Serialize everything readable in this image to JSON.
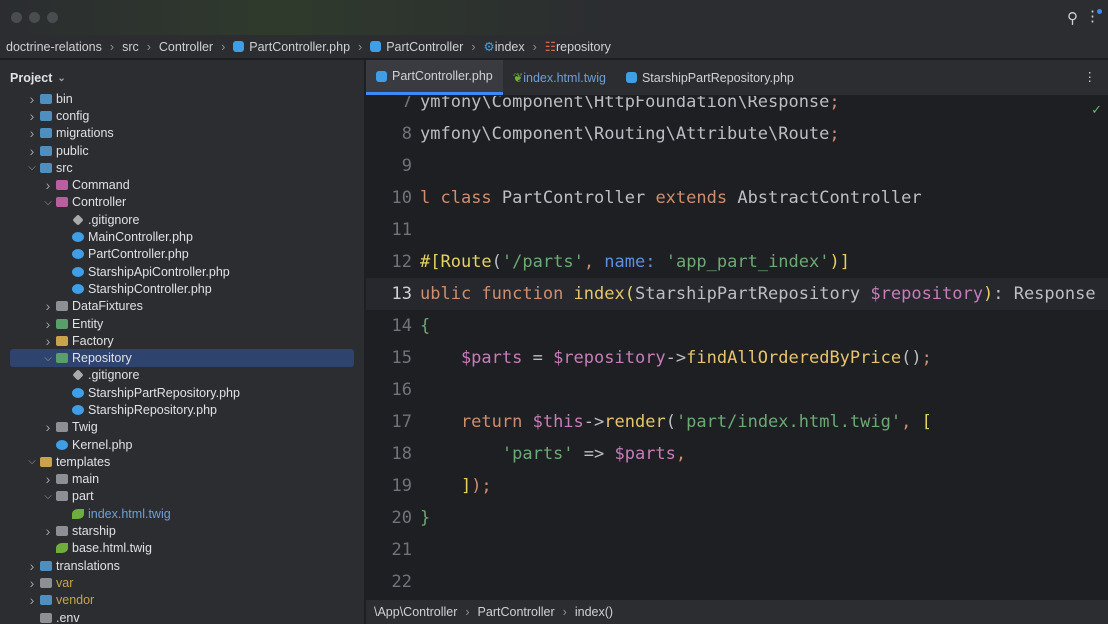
{
  "breadcrumb": [
    "doctrine-relations",
    "src",
    "Controller",
    "PartController.php",
    "PartController",
    "index",
    "repository"
  ],
  "sidebar": {
    "title": "Project",
    "tree": [
      {
        "l": 1,
        "n": "bin",
        "t": "folder",
        "c": ">"
      },
      {
        "l": 1,
        "n": "config",
        "t": "folder",
        "c": ">"
      },
      {
        "l": 1,
        "n": "migrations",
        "t": "folder",
        "c": ">"
      },
      {
        "l": 1,
        "n": "public",
        "t": "folder",
        "c": ">"
      },
      {
        "l": 1,
        "n": "src",
        "t": "folder",
        "c": "v"
      },
      {
        "l": 2,
        "n": "Command",
        "t": "folder",
        "c": ">"
      },
      {
        "l": 2,
        "n": "Controller",
        "t": "folder",
        "c": "v"
      },
      {
        "l": 3,
        "n": ".gitignore",
        "t": "git",
        "c": ""
      },
      {
        "l": 3,
        "n": "MainController.php",
        "t": "php",
        "c": ""
      },
      {
        "l": 3,
        "n": "PartController.php",
        "t": "php",
        "c": ""
      },
      {
        "l": 3,
        "n": "StarshipApiController.php",
        "t": "php",
        "c": ""
      },
      {
        "l": 3,
        "n": "StarshipController.php",
        "t": "php",
        "c": ""
      },
      {
        "l": 2,
        "n": "DataFixtures",
        "t": "folder",
        "c": ">"
      },
      {
        "l": 2,
        "n": "Entity",
        "t": "folder",
        "c": ">"
      },
      {
        "l": 2,
        "n": "Factory",
        "t": "folder",
        "c": ">"
      },
      {
        "l": 2,
        "n": "Repository",
        "t": "folder",
        "c": "v",
        "sel": true
      },
      {
        "l": 3,
        "n": ".gitignore",
        "t": "git",
        "c": ""
      },
      {
        "l": 3,
        "n": "StarshipPartRepository.php",
        "t": "php",
        "c": ""
      },
      {
        "l": 3,
        "n": "StarshipRepository.php",
        "t": "php",
        "c": ""
      },
      {
        "l": 2,
        "n": "Twig",
        "t": "folder",
        "c": ">"
      },
      {
        "l": 2,
        "n": "Kernel.php",
        "t": "php",
        "c": ""
      },
      {
        "l": 1,
        "n": "templates",
        "t": "folder",
        "c": "v"
      },
      {
        "l": 2,
        "n": "main",
        "t": "folder",
        "c": ">"
      },
      {
        "l": 2,
        "n": "part",
        "t": "folder",
        "c": "v"
      },
      {
        "l": 3,
        "n": "index.html.twig",
        "t": "twig",
        "c": "",
        "color": "#6e9fd8"
      },
      {
        "l": 2,
        "n": "starship",
        "t": "folder",
        "c": ">"
      },
      {
        "l": 2,
        "n": "base.html.twig",
        "t": "twig",
        "c": ""
      },
      {
        "l": 1,
        "n": "translations",
        "t": "folder",
        "c": ">"
      },
      {
        "l": 1,
        "n": "var",
        "t": "folder",
        "c": ">",
        "color": "#c9a34a"
      },
      {
        "l": 1,
        "n": "vendor",
        "t": "folder",
        "c": ">",
        "color": "#c9a34a"
      },
      {
        "l": 1,
        "n": ".env",
        "t": "file",
        "c": ""
      }
    ]
  },
  "tabs": [
    {
      "label": "PartController.php",
      "icon": "php",
      "active": true
    },
    {
      "label": "index.html.twig",
      "icon": "twig"
    },
    {
      "label": "StarshipPartRepository.php",
      "icon": "php"
    }
  ],
  "editor": {
    "current_line": "13",
    "lines": [
      {
        "n": "7",
        "t": [
          [
            "ymfony\\Component\\HttpFoundation\\Response",
            "pl"
          ],
          [
            ";",
            "kw"
          ]
        ]
      },
      {
        "n": "8",
        "t": [
          [
            "ymfony\\Component\\Routing\\Attribute\\Route",
            "pl"
          ],
          [
            ";",
            "kw"
          ]
        ]
      },
      {
        "n": "9",
        "t": []
      },
      {
        "n": "10",
        "t": [
          [
            "l ",
            "kw"
          ],
          [
            "class ",
            "kw"
          ],
          [
            "PartController ",
            "pl"
          ],
          [
            "extends ",
            "kw"
          ],
          [
            "AbstractController",
            "pl"
          ]
        ]
      },
      {
        "n": "11",
        "t": []
      },
      {
        "n": "12",
        "t": [
          [
            "#[",
            "br"
          ],
          [
            "Route",
            "br"
          ],
          [
            "(",
            "pl"
          ],
          [
            "'/parts'",
            "str"
          ],
          [
            ", ",
            "kw"
          ],
          [
            "name: ",
            "nm"
          ],
          [
            "'app_part_index'",
            "str"
          ],
          [
            ")]",
            "br"
          ]
        ]
      },
      {
        "n": "13",
        "t": [
          [
            "ublic ",
            "kw"
          ],
          [
            "function ",
            "kw"
          ],
          [
            "index",
            "fnc"
          ],
          [
            "(",
            "br"
          ],
          [
            "StarshipPartRepository ",
            "pl"
          ],
          [
            "$repository",
            "var"
          ],
          [
            ")",
            "br"
          ],
          [
            ": Response",
            "pl"
          ]
        ]
      },
      {
        "n": "14",
        "t": [
          [
            "{",
            "str"
          ]
        ]
      },
      {
        "n": "15",
        "t": [
          [
            "    $parts",
            "var"
          ],
          [
            " = ",
            "pl"
          ],
          [
            "$repository",
            "var"
          ],
          [
            "->",
            "pl"
          ],
          [
            "findAllOrderedByPrice",
            "fnc"
          ],
          [
            "()",
            "pl"
          ],
          [
            ";",
            "kw"
          ]
        ]
      },
      {
        "n": "16",
        "t": []
      },
      {
        "n": "17",
        "t": [
          [
            "    return ",
            "kw"
          ],
          [
            "$this",
            "var"
          ],
          [
            "->",
            "pl"
          ],
          [
            "render",
            "fnc"
          ],
          [
            "(",
            "pl"
          ],
          [
            "'part/index.html.twig'",
            "str"
          ],
          [
            ", ",
            "kw"
          ],
          [
            "[",
            "br"
          ]
        ]
      },
      {
        "n": "18",
        "t": [
          [
            "        'parts'",
            "str"
          ],
          [
            " => ",
            "pl"
          ],
          [
            "$parts",
            "var"
          ],
          [
            ",",
            "kw"
          ]
        ]
      },
      {
        "n": "19",
        "t": [
          [
            "    ]",
            "br"
          ],
          [
            ");",
            "kw"
          ]
        ]
      },
      {
        "n": "20",
        "t": [
          [
            "}",
            "str"
          ]
        ]
      },
      {
        "n": "21",
        "t": []
      },
      {
        "n": "22",
        "t": []
      }
    ]
  },
  "status": [
    "\\App\\Controller",
    "PartController",
    "index()"
  ]
}
